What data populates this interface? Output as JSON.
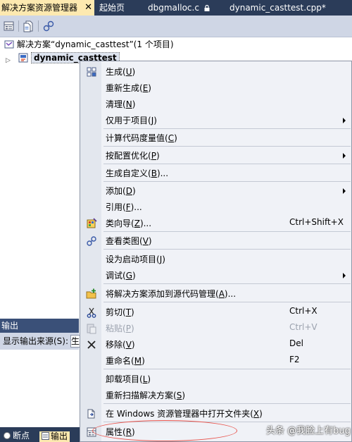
{
  "tabs": {
    "active": "解决方案资源管理器",
    "close_glyph": "✕",
    "tab2": "起始页",
    "tab3": "dbgmalloc.c",
    "tab4": "dynamic_casttest.cpp*"
  },
  "tree": {
    "solution_label": "解决方案“dynamic_casttest”(1 个项目)",
    "project_name": "dynamic_casttest",
    "expander": "▷"
  },
  "output": {
    "title": "输出",
    "source_label": "显示输出来源(S):",
    "source_value": "生"
  },
  "bottom_tabs": {
    "breakpoints": "断点",
    "output": "输出"
  },
  "menu": {
    "build": "生成",
    "build_key": "U",
    "rebuild": "重新生成",
    "rebuild_key": "E",
    "clean": "清理",
    "clean_key": "N",
    "project_only": "仅用于项目",
    "project_only_key": "J",
    "metrics": "计算代码度量值",
    "metrics_key": "C",
    "pgo": "按配置优化",
    "pgo_key": "P",
    "custom_build": "生成自定义",
    "custom_build_key": "B",
    "add": "添加",
    "add_key": "D",
    "references": "引用",
    "references_key": "F",
    "class_wizard": "类向导",
    "class_wizard_key": "Z",
    "class_wizard_shortcut": "Ctrl+Shift+X",
    "view_class": "查看类图",
    "view_class_key": "V",
    "set_startup": "设为启动项目",
    "set_startup_key": "J",
    "debug": "调试",
    "debug_key": "G",
    "add_source_control": "将解决方案添加到源代码管理",
    "add_source_control_key": "A",
    "cut": "剪切",
    "cut_key": "T",
    "cut_shortcut": "Ctrl+X",
    "paste": "粘贴",
    "paste_key": "P",
    "paste_shortcut": "Ctrl+V",
    "remove": "移除",
    "remove_key": "V",
    "remove_shortcut": "Del",
    "rename": "重命名",
    "rename_key": "M",
    "rename_shortcut": "F2",
    "unload": "卸载项目",
    "unload_key": "L",
    "rescan": "重新扫描解决方案",
    "rescan_key": "S",
    "open_in_explorer": "在 Windows 资源管理器中打开文件夹",
    "open_in_explorer_key": "X",
    "properties": "属性",
    "properties_key": "R"
  },
  "watermark": "头条 @我脸上有bug",
  "colors": {
    "tab_bg": "#2b3c59",
    "active_tab": "#fde9b0",
    "menu_bg": "#f0f2f7",
    "highlight_ellipse": "#e8554e"
  }
}
